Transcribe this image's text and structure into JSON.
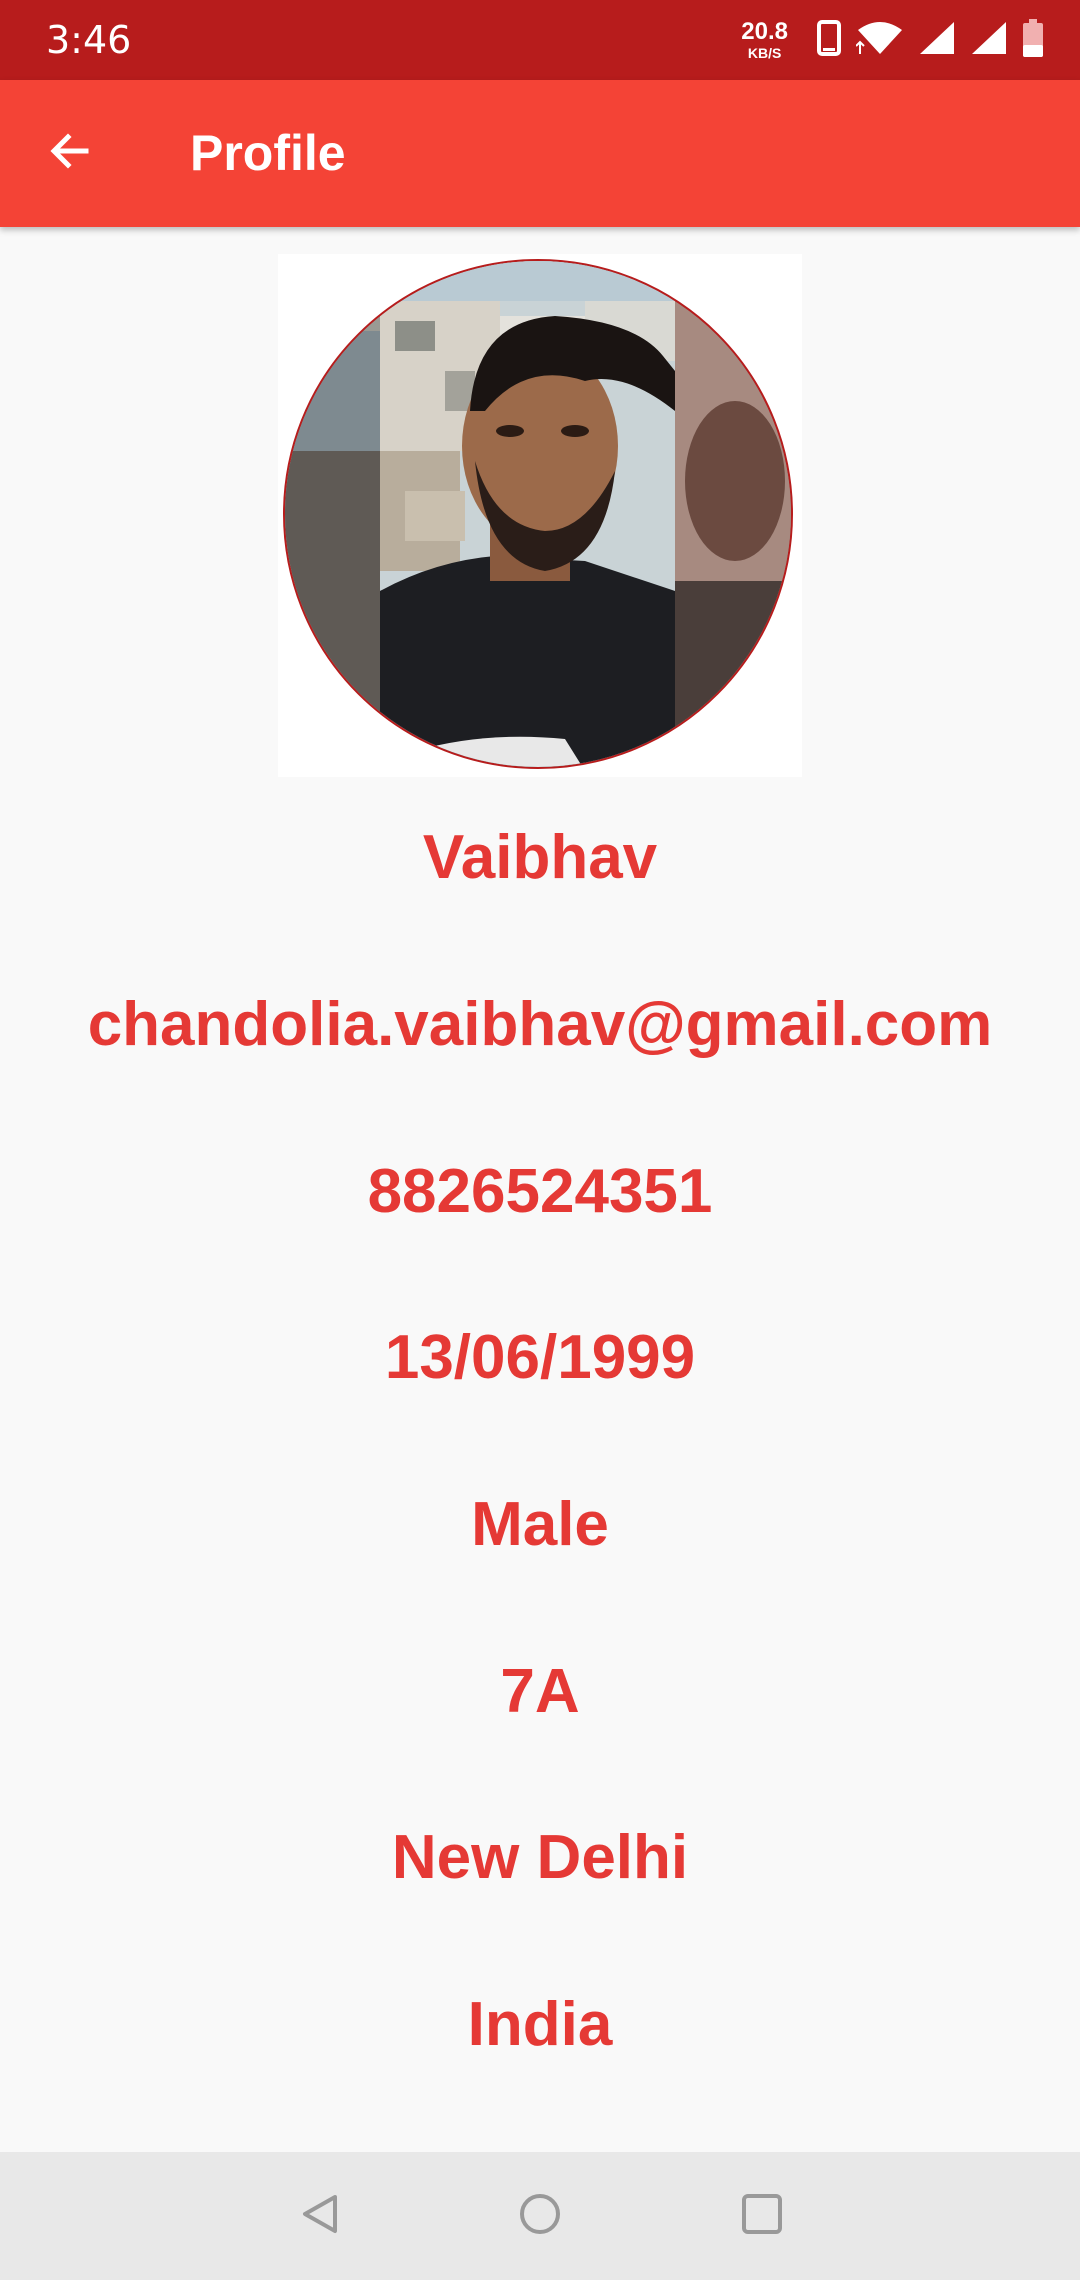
{
  "status_bar": {
    "time": "3:46",
    "net_speed_value": "20.8",
    "net_speed_unit": "KB/S",
    "icons": [
      "phone-icon",
      "wifi-icon",
      "signal-icon",
      "signal-icon",
      "battery-low-icon"
    ]
  },
  "app_bar": {
    "back_icon": "arrow-left-icon",
    "title": "Profile"
  },
  "profile": {
    "photo": "profile-photo",
    "name": "Vaibhav",
    "email": "chandolia.vaibhav@gmail.com",
    "phone": "8826524351",
    "dob": "13/06/1999",
    "gender": "Male",
    "address": "7A",
    "city": "New Delhi",
    "country": "India"
  },
  "nav_bar": {
    "buttons": [
      "back-triangle-icon",
      "home-circle-icon",
      "recents-square-icon"
    ]
  },
  "colors": {
    "status_bar": "#b71c1c",
    "app_bar": "#f44336",
    "text_accent": "#e53935",
    "background": "#f9f9f9",
    "nav_bar": "#e8e8e8"
  }
}
